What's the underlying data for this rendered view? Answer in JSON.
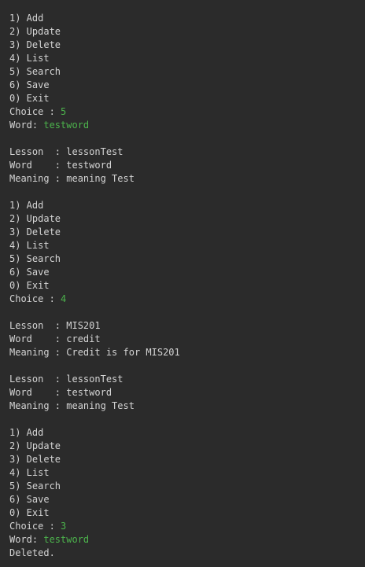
{
  "console": {
    "lines": [
      {
        "text": "1) Add"
      },
      {
        "text": "2) Update"
      },
      {
        "text": "3) Delete"
      },
      {
        "text": "4) List"
      },
      {
        "text": "5) Search"
      },
      {
        "text": "6) Save"
      },
      {
        "text": "0) Exit"
      },
      {
        "text": "Choice : ",
        "input": "5"
      },
      {
        "text": "Word: ",
        "input": "testword"
      },
      {
        "text": ""
      },
      {
        "text": "Lesson  : lessonTest"
      },
      {
        "text": "Word    : testword"
      },
      {
        "text": "Meaning : meaning Test"
      },
      {
        "text": ""
      },
      {
        "text": "1) Add"
      },
      {
        "text": "2) Update"
      },
      {
        "text": "3) Delete"
      },
      {
        "text": "4) List"
      },
      {
        "text": "5) Search"
      },
      {
        "text": "6) Save"
      },
      {
        "text": "0) Exit"
      },
      {
        "text": "Choice : ",
        "input": "4"
      },
      {
        "text": ""
      },
      {
        "text": "Lesson  : MIS201"
      },
      {
        "text": "Word    : credit"
      },
      {
        "text": "Meaning : Credit is for MIS201"
      },
      {
        "text": ""
      },
      {
        "text": "Lesson  : lessonTest"
      },
      {
        "text": "Word    : testword"
      },
      {
        "text": "Meaning : meaning Test"
      },
      {
        "text": ""
      },
      {
        "text": "1) Add"
      },
      {
        "text": "2) Update"
      },
      {
        "text": "3) Delete"
      },
      {
        "text": "4) List"
      },
      {
        "text": "5) Search"
      },
      {
        "text": "6) Save"
      },
      {
        "text": "0) Exit"
      },
      {
        "text": "Choice : ",
        "input": "3"
      },
      {
        "text": "Word: ",
        "input": "testword"
      },
      {
        "text": "Deleted."
      }
    ]
  }
}
